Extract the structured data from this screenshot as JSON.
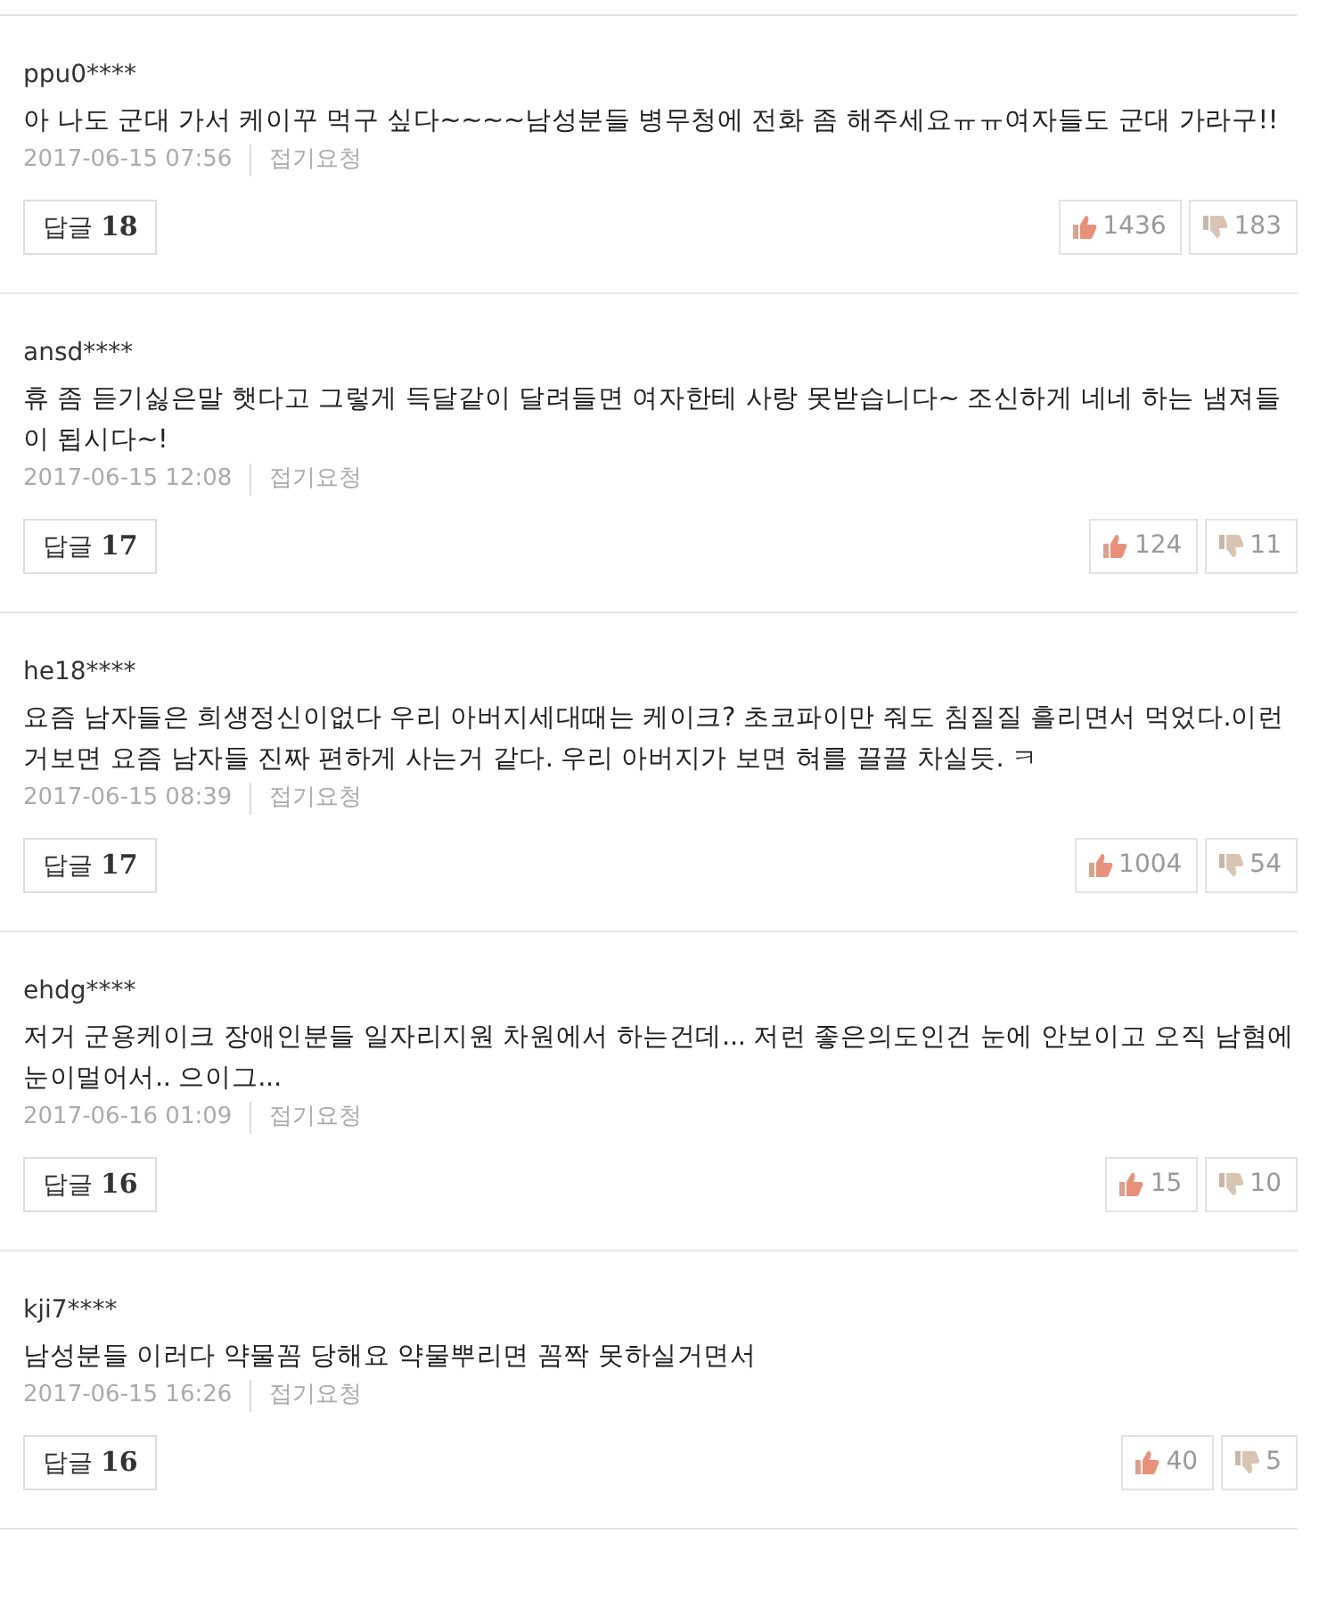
{
  "comments": [
    {
      "user": "ppu0****",
      "text": "아 나도 군대 가서 케이꾸 먹구 싶다~~~~남성분들 병무청에 전화 좀 해주세요ㅠㅠ여자들도 군대 가라구!!",
      "date": "2017-06-15 07:56",
      "report": "접기요청",
      "reply_label": "답글",
      "reply_count": "18",
      "likes": "1436",
      "dislikes": "183"
    },
    {
      "user": "ansd****",
      "text": "휴 좀 듣기싫은말 햇다고 그렇게 득달같이 달려들면 여자한테 사랑 못받습니다~ 조신하게 네네 하는 냄져들이 됩시다~!",
      "date": "2017-06-15 12:08",
      "report": "접기요청",
      "reply_label": "답글",
      "reply_count": "17",
      "likes": "124",
      "dislikes": "11"
    },
    {
      "user": "he18****",
      "text": "요즘 남자들은 희생정신이없다 우리 아버지세대때는 케이크? 초코파이만 줘도 침질질 흘리면서 먹었다.이런거보면 요즘 남자들 진짜 편하게 사는거 같다. 우리 아버지가 보면 혀를 끌끌 차실듯. ㅋ",
      "date": "2017-06-15 08:39",
      "report": "접기요청",
      "reply_label": "답글",
      "reply_count": "17",
      "likes": "1004",
      "dislikes": "54"
    },
    {
      "user": "ehdg****",
      "text": "저거 군용케이크 장애인분들 일자리지원 차원에서 하는건데... 저런 좋은의도인건 눈에 안보이고 오직 남혐에 눈이멀어서.. 으이그...",
      "date": "2017-06-16 01:09",
      "report": "접기요청",
      "reply_label": "답글",
      "reply_count": "16",
      "likes": "15",
      "dislikes": "10"
    },
    {
      "user": "kji7****",
      "text": "남성분들 이러다 약물꼼 당해요 약물뿌리면 꼼짝 못하실거면서",
      "date": "2017-06-15 16:26",
      "report": "접기요청",
      "reply_label": "답글",
      "reply_count": "16",
      "likes": "40",
      "dislikes": "5"
    }
  ]
}
